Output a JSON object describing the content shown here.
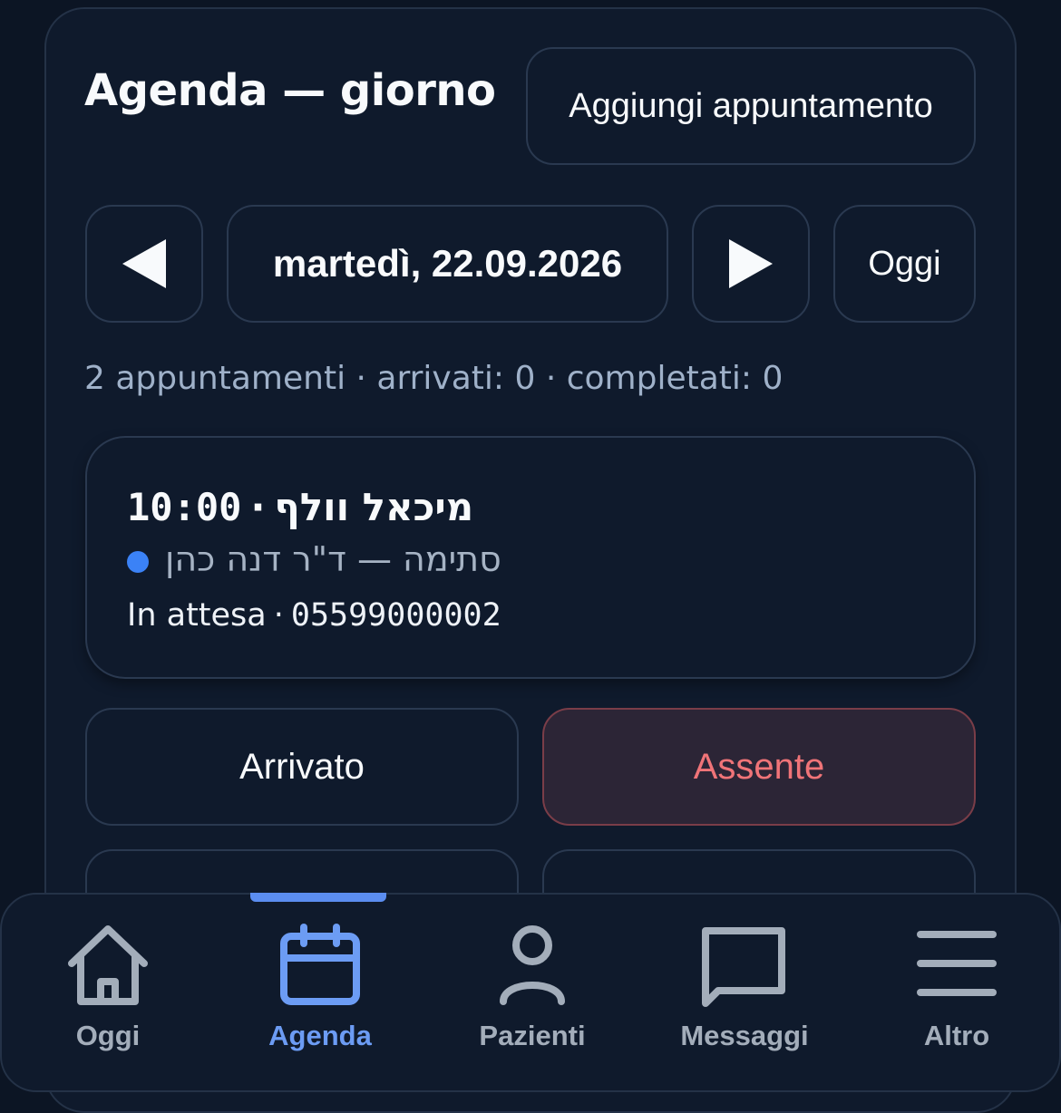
{
  "header": {
    "title": "Agenda — giorno",
    "add_button": "Aggiungi appuntamento"
  },
  "date_nav": {
    "prev_icon": "triangle-left-icon",
    "date": "martedì, 22.09.2026",
    "next_icon": "triangle-right-icon",
    "today_button": "Oggi"
  },
  "summary": "2 appuntamenti · arrivati: 0 · completati: 0",
  "appointments": [
    {
      "time": "10:00",
      "patient": "מיכאל וולף",
      "service_doctor": "סתימה — ד\"ר דנה כהן",
      "status_color": "#3b82f6",
      "status": "In attesa",
      "phone": "05599000002"
    }
  ],
  "actions": {
    "arrived": "Arrivato",
    "absent": "Assente"
  },
  "bottom_nav": {
    "active_index": 1,
    "items": [
      {
        "label": "Oggi",
        "icon": "home-icon"
      },
      {
        "label": "Agenda",
        "icon": "calendar-icon"
      },
      {
        "label": "Pazienti",
        "icon": "user-icon"
      },
      {
        "label": "Messaggi",
        "icon": "message-icon"
      },
      {
        "label": "Altro",
        "icon": "menu-icon"
      }
    ]
  },
  "colors": {
    "accent": "#6c9cf4",
    "absent": "#f07478",
    "background": "#0f1a2c"
  }
}
